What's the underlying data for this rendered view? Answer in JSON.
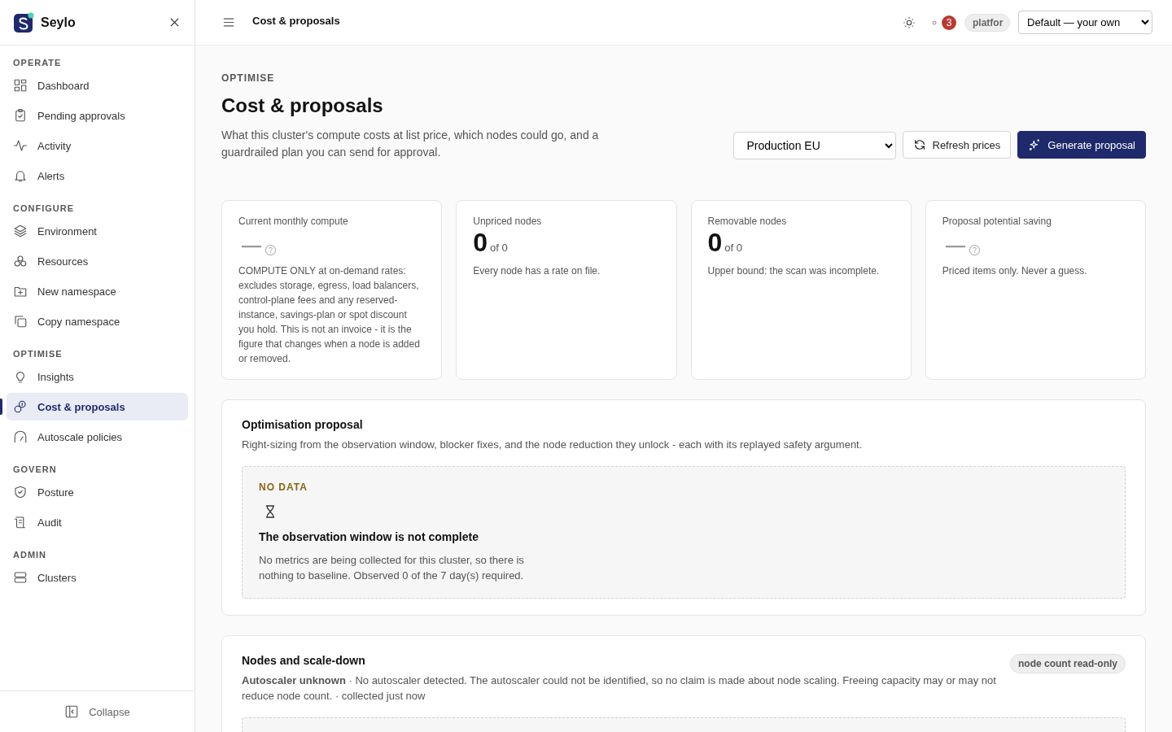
{
  "brand": {
    "name": "Seylo"
  },
  "sidebar": {
    "sections": [
      {
        "title": "OPERATE",
        "items": [
          {
            "label": "Dashboard",
            "selected": false
          },
          {
            "label": "Pending approvals",
            "selected": false
          },
          {
            "label": "Activity",
            "selected": false
          },
          {
            "label": "Alerts",
            "selected": false
          }
        ]
      },
      {
        "title": "CONFIGURE",
        "items": [
          {
            "label": "Environment",
            "selected": false
          },
          {
            "label": "Resources",
            "selected": false
          },
          {
            "label": "New namespace",
            "selected": false
          },
          {
            "label": "Copy namespace",
            "selected": false
          }
        ]
      },
      {
        "title": "OPTIMISE",
        "items": [
          {
            "label": "Insights",
            "selected": false
          },
          {
            "label": "Cost & proposals",
            "selected": true
          },
          {
            "label": "Autoscale policies",
            "selected": false
          }
        ]
      },
      {
        "title": "GOVERN",
        "items": [
          {
            "label": "Posture",
            "selected": false
          },
          {
            "label": "Audit",
            "selected": false
          }
        ]
      },
      {
        "title": "ADMIN",
        "items": [
          {
            "label": "Clusters",
            "selected": false
          }
        ]
      }
    ],
    "collapse": "Collapse"
  },
  "topbar": {
    "title": "Cost & proposals",
    "notification_count": "3",
    "user_chip": "platfor",
    "scope_select": "Default — your own"
  },
  "header": {
    "eyebrow": "OPTIMISE",
    "title": "Cost & proposals",
    "description": "What this cluster's compute costs at list price, which nodes could go, and a guardrailed plan you can send for approval.",
    "cluster_select": "Production EU",
    "refresh_button": "Refresh prices",
    "generate_button": "Generate proposal"
  },
  "stats": [
    {
      "kind": "dash",
      "label": "Current monthly compute",
      "note": "COMPUTE ONLY at on-demand rates: excludes storage, egress, load balancers, control-plane fees and any reserved-instance, savings-plan or spot discount you hold. This is not an invoice - it is the figure that changes when a node is added or removed."
    },
    {
      "kind": "count",
      "label": "Unpriced nodes",
      "value": "0",
      "of": "of 0",
      "note": "Every node has a rate on file."
    },
    {
      "kind": "count",
      "label": "Removable nodes",
      "value": "0",
      "of": "of 0",
      "note": "Upper bound: the scan was incomplete."
    },
    {
      "kind": "dash",
      "label": "Proposal potential saving",
      "note": "Priced items only. Never a guess."
    }
  ],
  "proposal": {
    "title": "Optimisation proposal",
    "description": "Right-sizing from the observation window, blocker fixes, and the node reduction they unlock - each with its replayed safety argument.",
    "empty": {
      "tag": "NO DATA",
      "title": "The observation window is not complete",
      "text": "No metrics are being collected for this cluster, so there is nothing to baseline. Observed 0 of the 7 day(s) required."
    }
  },
  "nodes": {
    "title": "Nodes and scale-down",
    "badge": "node count read-only",
    "description": "**Autoscaler unknown** · No autoscaler detected. The autoscaler could not be identified, so no claim is made about node scaling. Freeing capacity may or may not reduce node count. · collected just now"
  }
}
